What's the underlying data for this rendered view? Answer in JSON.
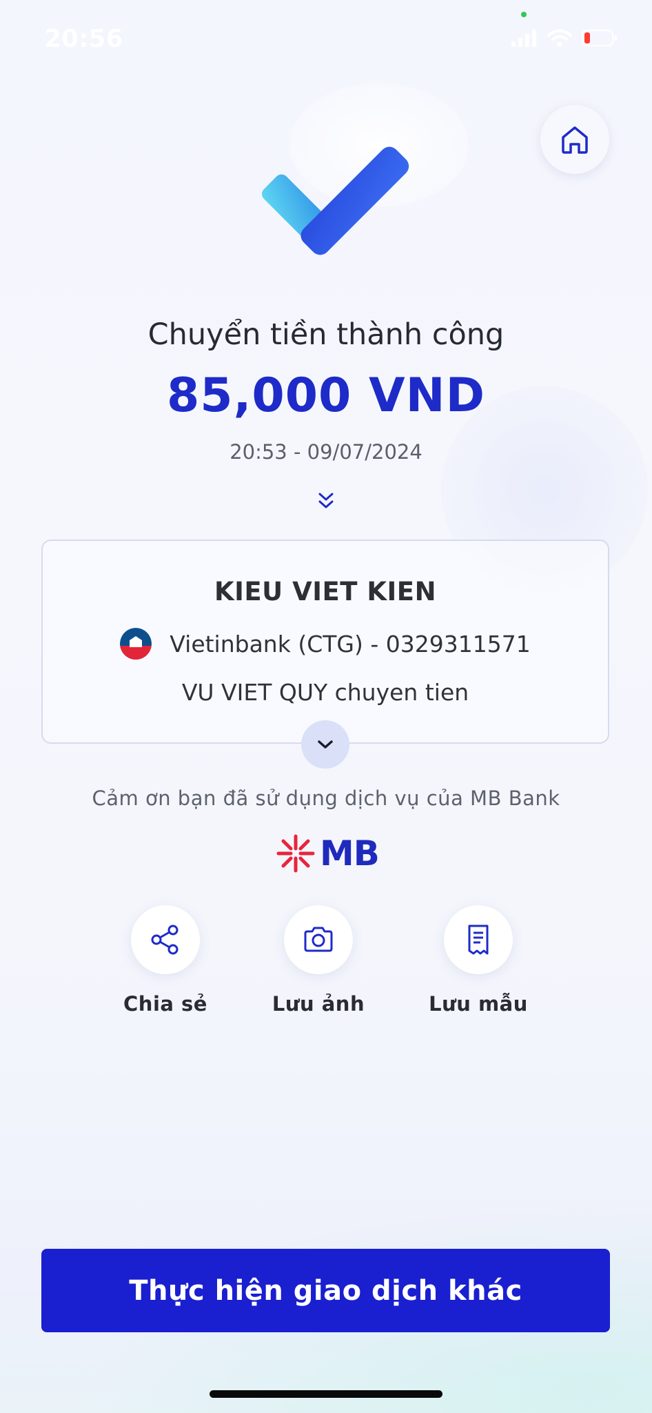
{
  "status_bar": {
    "time": "20:56"
  },
  "header": {
    "home_icon": "home-icon"
  },
  "result": {
    "title": "Chuyển tiền thành công",
    "amount": "85,000 VND",
    "datetime": "20:53 - 09/07/2024"
  },
  "transfer": {
    "recipient_name": "KIEU VIET KIEN",
    "bank_account": "Vietinbank (CTG) - 0329311571",
    "memo": "VU VIET QUY chuyen tien"
  },
  "footer": {
    "thanks": "Cảm ơn bạn đã sử dụng dịch vụ của MB Bank",
    "brand": "MB"
  },
  "actions": [
    {
      "label": "Chia sẻ",
      "icon": "share-icon"
    },
    {
      "label": "Lưu ảnh",
      "icon": "camera-icon"
    },
    {
      "label": "Lưu mẫu",
      "icon": "receipt-icon"
    }
  ],
  "primary_button": {
    "label": "Thực hiện giao dịch khác"
  },
  "colors": {
    "accent": "#1E2BC8",
    "button": "#1A1FD0",
    "brand_red": "#E8253B"
  }
}
